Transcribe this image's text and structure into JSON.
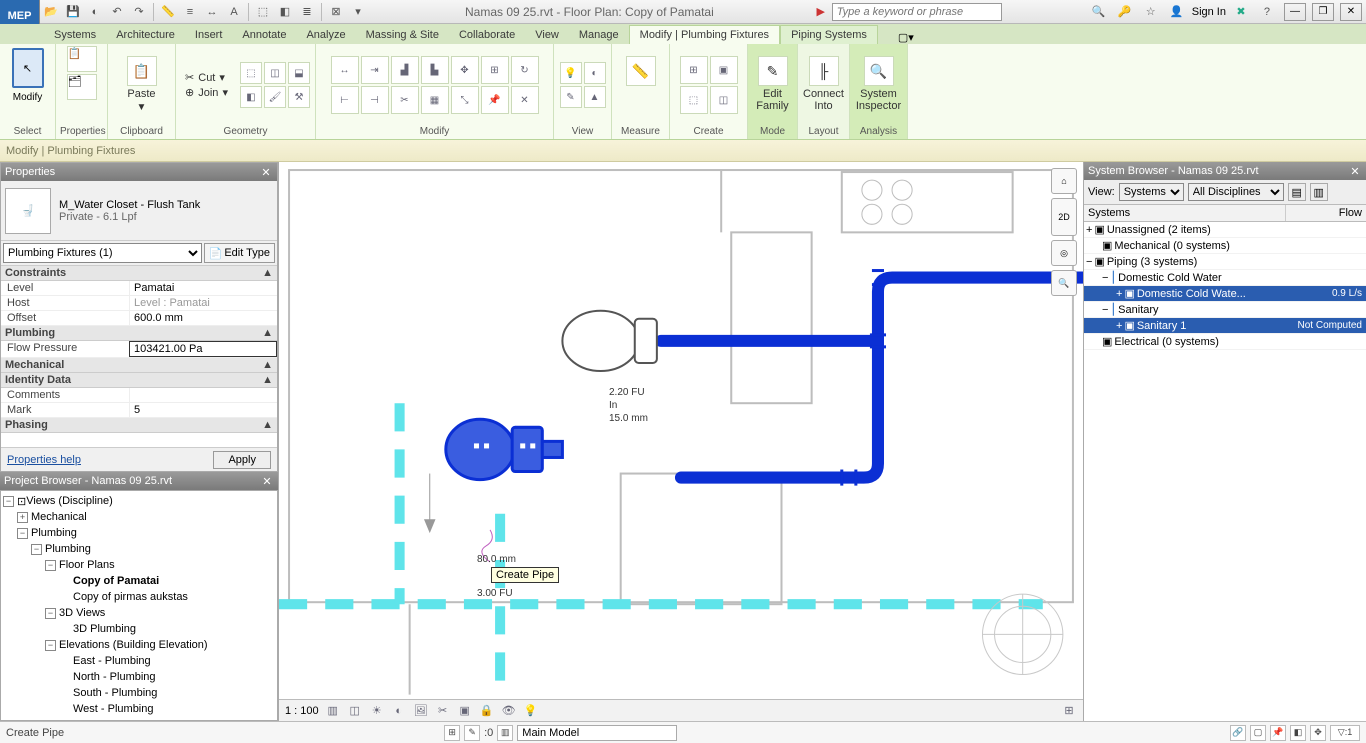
{
  "app_label": "MEP",
  "title": "Namas 09 25.rvt - Floor Plan: Copy of Pamatai",
  "search_placeholder": "Type a keyword or phrase",
  "signin": "Sign In",
  "tabs": [
    "Systems",
    "Architecture",
    "Insert",
    "Annotate",
    "Analyze",
    "Massing & Site",
    "Collaborate",
    "View",
    "Manage"
  ],
  "ctx_tabs": [
    "Modify | Plumbing Fixtures",
    "Piping Systems"
  ],
  "panels": {
    "select": "Select",
    "properties": "Properties",
    "clipboard": "Clipboard",
    "geometry": "Geometry",
    "modify": "Modify",
    "view": "View",
    "measure": "Measure",
    "create": "Create",
    "mode": "Mode",
    "layout": "Layout",
    "analysis": "Analysis"
  },
  "ribbon": {
    "modify": "Modify",
    "paste": "Paste",
    "cut": "Cut",
    "join": "Join",
    "edit_family": "Edit\nFamily",
    "connect_into": "Connect\nInto",
    "system_inspector": "System\nInspector"
  },
  "ctxbar": "Modify | Plumbing Fixtures",
  "props": {
    "title": "Properties",
    "type_name": "M_Water Closet - Flush Tank",
    "type_sub": "Private - 6.1 Lpf",
    "selector": "Plumbing Fixtures (1)",
    "edit_type": "Edit Type",
    "cats": {
      "constraints": "Constraints",
      "plumbing": "Plumbing",
      "mechanical": "Mechanical",
      "identity": "Identity Data",
      "phasing": "Phasing"
    },
    "rows": {
      "level": {
        "k": "Level",
        "v": "Pamatai"
      },
      "host": {
        "k": "Host",
        "v": "Level : Pamatai"
      },
      "offset": {
        "k": "Offset",
        "v": "600.0 mm"
      },
      "flow_pressure": {
        "k": "Flow Pressure",
        "v": "103421.00 Pa"
      },
      "comments": {
        "k": "Comments",
        "v": ""
      },
      "mark": {
        "k": "Mark",
        "v": "5"
      }
    },
    "help": "Properties help",
    "apply": "Apply"
  },
  "pb": {
    "title": "Project Browser - Namas 09 25.rvt",
    "root": "Views (Discipline)",
    "mech": "Mechanical",
    "plumbing": "Plumbing",
    "plumbing2": "Plumbing",
    "floorplans": "Floor Plans",
    "fp1": "Copy of Pamatai",
    "fp2": "Copy of pirmas aukstas",
    "views3d": "3D Views",
    "v3d": "3D Plumbing",
    "elev": "Elevations (Building Elevation)",
    "e1": "East - Plumbing",
    "e2": "North - Plumbing",
    "e3": "South - Plumbing",
    "e4": "West - Plumbing"
  },
  "canvas": {
    "fu_top": "2.20 FU",
    "in": "In",
    "dia": "15.0 mm",
    "dia2": "80.0 mm",
    "fu_bot": "3.00 FU",
    "tooltip": "Create Pipe",
    "scale": "1 : 100"
  },
  "sb": {
    "title": "System Browser - Namas 09 25.rvt",
    "view_lbl": "View:",
    "view_sel": "Systems",
    "disc_sel": "All Disciplines",
    "h1": "Systems",
    "h2": "Flow",
    "rows": {
      "unassigned": "Unassigned (2 items)",
      "mech": "Mechanical (0 systems)",
      "piping": "Piping (3 systems)",
      "dcw": "Domestic Cold Water",
      "dcw1": "Domestic Cold Wate...",
      "dcw1_v": "0.9 L/s",
      "san": "Sanitary",
      "san1": "Sanitary 1",
      "san1_v": "Not Computed",
      "elec": "Electrical (0 systems)"
    }
  },
  "status": {
    "msg": "Create Pipe",
    "zero": ":0",
    "main_model": "Main Model"
  }
}
